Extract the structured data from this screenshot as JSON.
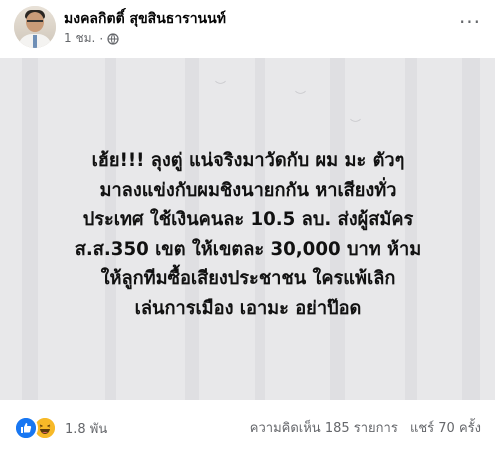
{
  "author": {
    "name": "มงคลกิตติ์ สุขสินธารานนท์",
    "timestamp": "1 ชม."
  },
  "post": {
    "lines": [
      "เฮ้ย!!! ลุงตู่ แน่จริงมาวัดกับ ผม มะ ตัวๆ",
      "มาลงแข่งกับผมชิงนายกกัน หาเสียงทั่ว",
      "ประเทศ ใช้เงินคนละ 10.5 ลบ. ส่งผู้สมัคร",
      "ส.ส.350 เขต ให้เขตละ 30,000 บาท ห้าม",
      "ให้ลูกทีมซื้อเสียงประชาชน ใครแพ้เลิก",
      "เล่นการเมือง เอามะ อย่าป๊อด"
    ]
  },
  "reactions": {
    "count": "1.8 พัน",
    "types": [
      "like-icon",
      "haha-icon"
    ],
    "colors": {
      "like": "#1877f2",
      "haha": "#f7b928"
    }
  },
  "stats": {
    "comments": "ความคิดเห็น 185 รายการ",
    "shares": "แชร์ 70 ครั้ง"
  }
}
